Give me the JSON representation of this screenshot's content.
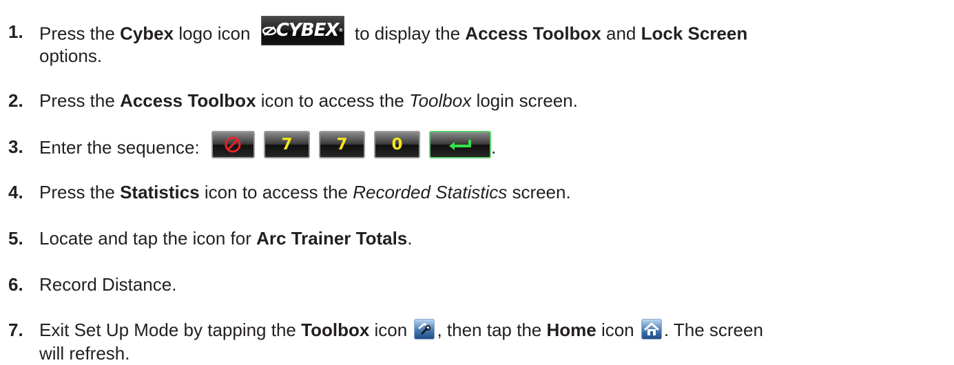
{
  "steps": [
    {
      "num": "1.",
      "line1_a": "Press the ",
      "b1": "Cybex",
      "line1_b": " logo icon ",
      "line1_c": " to display the ",
      "b2": "Access Toolbox",
      "line1_d": " and ",
      "b3": "Lock Screen",
      "line2": "options."
    },
    {
      "num": "2.",
      "a": "Press the ",
      "b": "Access Toolbox",
      "c": " icon to access the ",
      "i": "Toolbox",
      "d": " login screen."
    },
    {
      "num": "3.",
      "a": "Enter the sequence: ",
      "end": ".",
      "keys": [
        "7",
        "7",
        "0"
      ]
    },
    {
      "num": "4.",
      "a": "Press the ",
      "b": "Statistics",
      "c": " icon to access the ",
      "i": "Recorded Statistics",
      "d": " screen."
    },
    {
      "num": "5.",
      "a": "Locate and tap the icon for ",
      "b": "Arc Trainer Totals",
      "c": "."
    },
    {
      "num": "6.",
      "a": "Record Distance."
    },
    {
      "num": "7.",
      "a": "Exit Set Up Mode by tapping the ",
      "b": "Toolbox",
      "c": " icon ",
      "d": ", then tap the ",
      "e": "Home",
      "f": " icon ",
      "g": ". The screen",
      "line2": "will refresh."
    }
  ],
  "logo": {
    "text": "CYBEX",
    "mark": "®",
    "icon": "cybex-logo-icon"
  },
  "colors": {
    "text": "#231f20",
    "key_digit": "#f4e41f",
    "cancel_red": "#e8232b",
    "enter_green": "#35e04c",
    "icon_blue": "#4a7bb2"
  }
}
